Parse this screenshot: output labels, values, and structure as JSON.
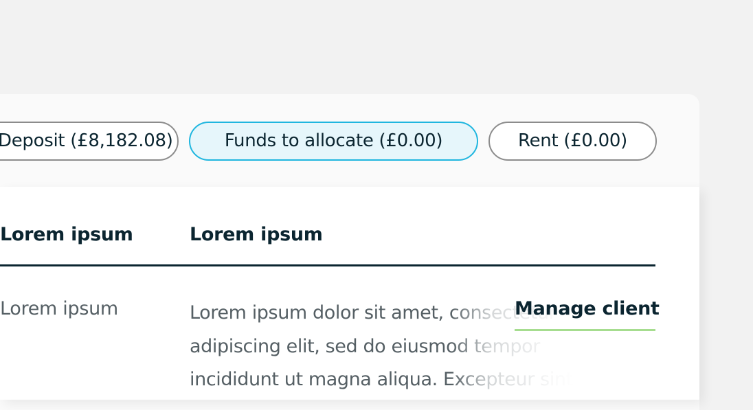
{
  "filters": {
    "deposit_label": "Deposit (£8,182.08)",
    "funds_label": "Funds to allocate (£0.00)",
    "rent_label": "Rent (£0.00)",
    "active": "Funds to allocate (£0.00)"
  },
  "table": {
    "headers": [
      "Lorem ipsum",
      "Lorem ipsum"
    ],
    "rows": [
      {
        "col1": "Lorem ipsum",
        "col2_lines": [
          "Lorem ipsum dolor sit amet, consectetur",
          "adipiscing elit, sed do eiusmod tempor",
          "incididunt ut magna aliqua. Excepteur sint"
        ],
        "action_label": "Manage client"
      }
    ]
  },
  "colors": {
    "page_background": "#f2f2f2",
    "text_primary": "#0b2530",
    "text_secondary": "#555f64",
    "active_pill_border": "#1fb6df",
    "active_pill_fill": "#e6f6fb",
    "link_underline": "#a6dd8f"
  }
}
